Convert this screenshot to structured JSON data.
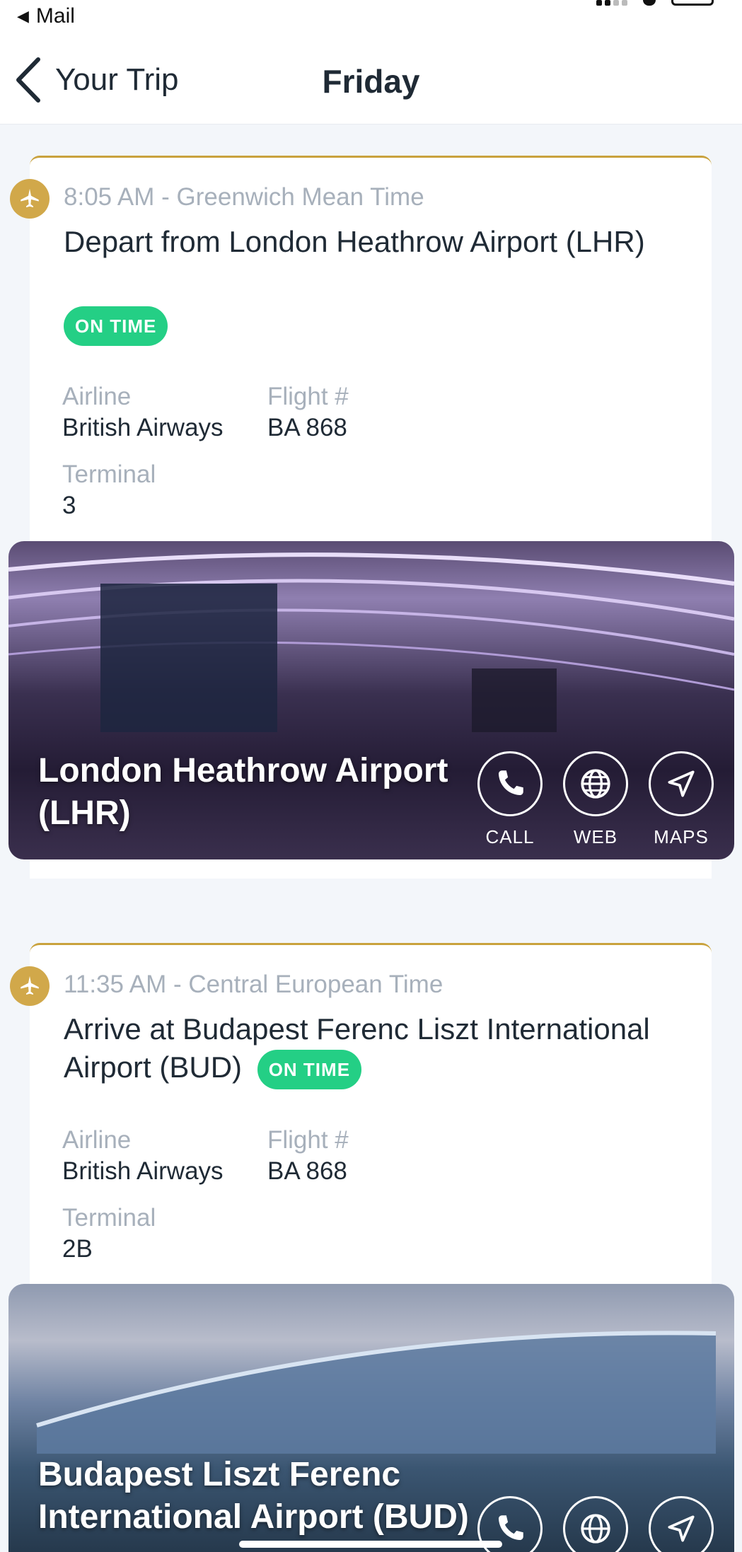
{
  "status_bar": {
    "back_app": "Mail"
  },
  "nav": {
    "back_label": "Your Trip",
    "title": "Friday"
  },
  "segments": [
    {
      "time": "8:05 AM - Greenwich Mean Time",
      "title": "Depart from London Heathrow Airport (LHR)",
      "status": "ON TIME",
      "airline_label": "Airline",
      "airline": "British Airways",
      "flight_label": "Flight #",
      "flight": "BA 868",
      "terminal_label": "Terminal",
      "terminal": "3",
      "place": "London Heathrow Airport (LHR)"
    },
    {
      "time": "11:35 AM - Central European Time",
      "title": "Arrive at Budapest Ferenc Liszt International Airport (BUD)",
      "status": "ON TIME",
      "airline_label": "Airline",
      "airline": "British Airways",
      "flight_label": "Flight #",
      "flight": "BA 868",
      "terminal_label": "Terminal",
      "terminal": "2B",
      "place": "Budapest Liszt Ferenc International Airport (BUD)"
    }
  ],
  "actions": {
    "call": "CALL",
    "web": "WEB",
    "maps": "MAPS"
  },
  "icons": {
    "plane": "airplane-icon",
    "call": "phone-icon",
    "web": "globe-icon",
    "maps": "navigation-arrow-icon"
  },
  "colors": {
    "accent": "#c9a23d",
    "badge": "#d1a84a",
    "status": "#24cf85"
  }
}
